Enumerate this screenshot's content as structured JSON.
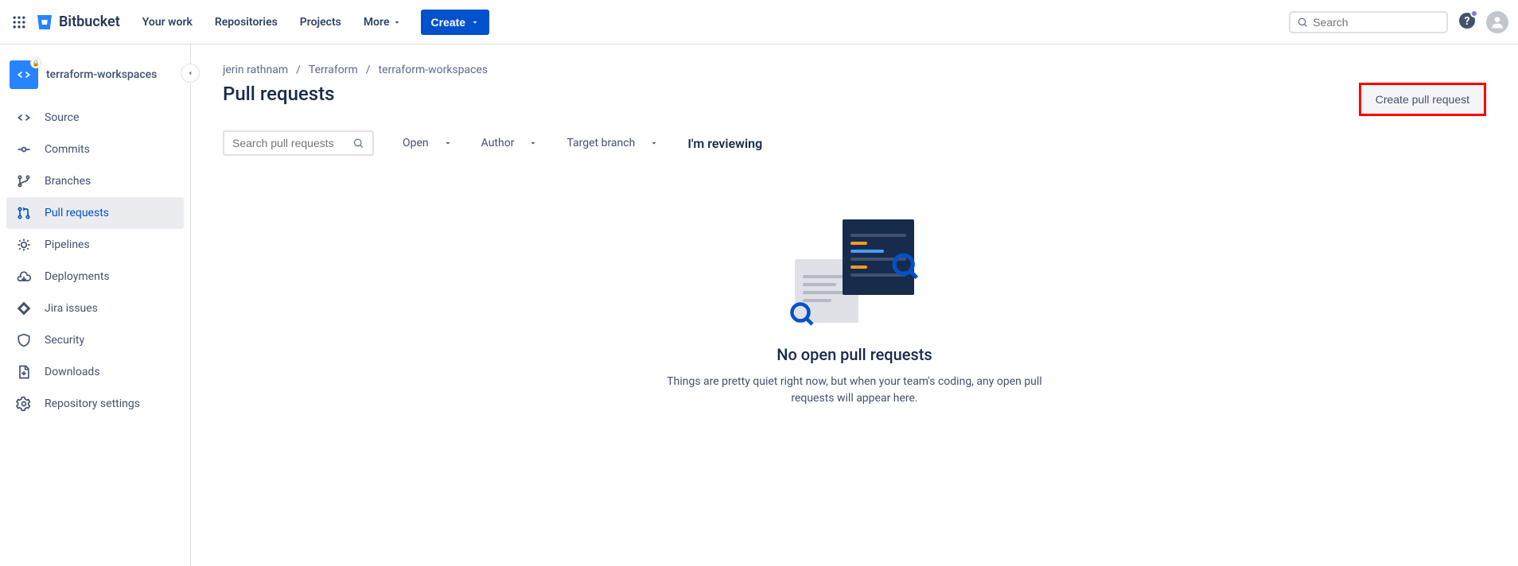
{
  "header": {
    "product": "Bitbucket",
    "nav": [
      "Your work",
      "Repositories",
      "Projects",
      "More"
    ],
    "create": "Create",
    "search_placeholder": "Search"
  },
  "sidebar": {
    "repo_name": "terraform-workspaces",
    "items": [
      {
        "label": "Source"
      },
      {
        "label": "Commits"
      },
      {
        "label": "Branches"
      },
      {
        "label": "Pull requests"
      },
      {
        "label": "Pipelines"
      },
      {
        "label": "Deployments"
      },
      {
        "label": "Jira issues"
      },
      {
        "label": "Security"
      },
      {
        "label": "Downloads"
      },
      {
        "label": "Repository settings"
      }
    ]
  },
  "breadcrumb": [
    "jerin rathnam",
    "Terraform",
    "terraform-workspaces"
  ],
  "page": {
    "title": "Pull requests",
    "create_pr": "Create pull request",
    "search_placeholder": "Search pull requests",
    "filters": {
      "status": "Open",
      "author": "Author",
      "target": "Target branch",
      "reviewing": "I'm reviewing"
    },
    "empty": {
      "title": "No open pull requests",
      "desc": "Things are pretty quiet right now, but when your team's coding, any open pull requests will appear here."
    }
  }
}
